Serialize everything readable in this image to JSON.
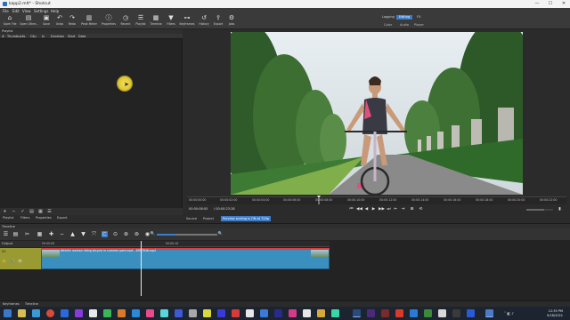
{
  "window": {
    "title": "kapp2.mlt* - Shotcut",
    "min": "—",
    "max": "☐",
    "close": "✕"
  },
  "menu": [
    "File",
    "Edit",
    "View",
    "Settings",
    "Help"
  ],
  "toolbar": [
    {
      "label": "Open File",
      "icon": "⌂"
    },
    {
      "label": "Open Other...",
      "icon": "▤"
    },
    {
      "label": "Save",
      "icon": "▣"
    },
    {
      "label": "Undo",
      "icon": "↶"
    },
    {
      "label": "Redo",
      "icon": "↷"
    },
    {
      "label": "Peak Meter",
      "icon": "▥"
    },
    {
      "label": "Properties",
      "icon": "ⓘ"
    },
    {
      "label": "Recent",
      "icon": "◷"
    },
    {
      "label": "Playlist",
      "icon": "☰"
    },
    {
      "label": "Timeline",
      "icon": "▦"
    },
    {
      "label": "Filters",
      "icon": "▼"
    },
    {
      "label": "Keyframes",
      "icon": "⊶"
    },
    {
      "label": "History",
      "icon": "↺"
    },
    {
      "label": "Export",
      "icon": "⇪"
    },
    {
      "label": "Jobs",
      "icon": "⚙"
    }
  ],
  "layouts": {
    "top": [
      "Logging",
      "Editing",
      "FX"
    ],
    "selected": "Editing",
    "bottom": [
      "Color",
      "Audio",
      "Player"
    ]
  },
  "playlist": {
    "title": "Playlist",
    "columns": [
      "#",
      "Thumbnails",
      "Clip",
      "In",
      "Duration",
      "Start",
      "Date"
    ],
    "buttons": [
      "+",
      "−",
      "✓",
      "▤",
      "▦",
      "☰"
    ],
    "tabs": [
      "Playlist",
      "Filters",
      "Properties",
      "Export"
    ]
  },
  "viewer": {
    "ticks": [
      "00:00:00:00",
      "00:00:02:00",
      "00:00:04:00",
      "00:00:06:00",
      "00:00:08:00",
      "00:00:10:00",
      "00:00:12:00",
      "00:00:14:00",
      "00:00:16:00",
      "00:00:18:00",
      "00:00:20:00",
      "00:00:22:00"
    ],
    "timecode": "00:00:08:05",
    "duration": "/ 00:00:23:28",
    "transport": [
      "⏮",
      "◀◀",
      "◀",
      "▶",
      "▶▶",
      "⏭",
      "⇤",
      "⇥",
      "⊞",
      "⟲"
    ],
    "tabs": [
      "Source",
      "Project"
    ],
    "notice": "Preview scaling is ON at 720p"
  },
  "timeline": {
    "title": "Timeline",
    "buttons": [
      "☰",
      "▤",
      "✂",
      "▦",
      "✚",
      "−",
      "▲",
      "▼",
      "⤧",
      "⊏",
      "⊙",
      "⊛",
      "⊚",
      "◉",
      "🔍"
    ],
    "zoom_in": "🔍",
    "output_label": "Output",
    "track": {
      "name": "V1",
      "lock": "🔒",
      "mute": "🔊",
      "eye": "👁"
    },
    "ruler": [
      "00:00:00",
      "00:00:10"
    ],
    "clip_name": "Athletic woman riding bicycle in summer park.mp4 - 8957846.mp4"
  },
  "bottom_tabs": [
    "Keyframes",
    "Timeline"
  ],
  "taskbar": {
    "time": "12:35 PM",
    "date": "5/18/2021"
  },
  "colors": {
    "accent": "#3d7cc9",
    "clip": "#3b8fbf",
    "track_header": "#9a9a32"
  }
}
